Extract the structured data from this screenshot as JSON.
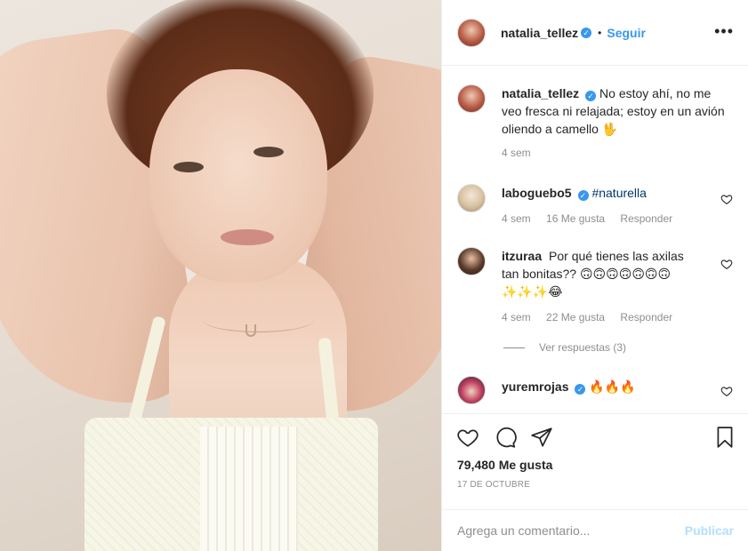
{
  "header": {
    "username": "natalia_tellez",
    "verified_icon": "verified-badge-icon",
    "separator": "•",
    "follow_label": "Seguir",
    "more_icon": "more-options-icon"
  },
  "caption": {
    "username": "natalia_tellez",
    "text": "No estoy ahí, no me veo fresca ni relajada; estoy en un avión oliendo a camello 🖖",
    "time": "4 sem"
  },
  "comments": [
    {
      "username": "laboguebo5",
      "verified": true,
      "text": "#naturella",
      "time": "4 sem",
      "likes": "16 Me gusta",
      "reply_label": "Responder"
    },
    {
      "username": "itzuraa",
      "verified": false,
      "text": "Por qué tienes las axilas tan bonitas?? 🙃🙃🙃🙃🙃🙃🙃✨✨✨😂",
      "time": "4 sem",
      "likes": "22 Me gusta",
      "reply_label": "Responder",
      "view_replies": "Ver respuestas (3)"
    },
    {
      "username": "yuremrojas",
      "verified": true,
      "text": "🔥🔥🔥"
    }
  ],
  "actions": {
    "like_icon": "heart-icon",
    "comment_icon": "comment-icon",
    "share_icon": "share-icon",
    "save_icon": "bookmark-icon",
    "likes": "79,480 Me gusta",
    "date": "17 DE OCTUBRE"
  },
  "add_comment": {
    "placeholder": "Agrega un comentario...",
    "publish_label": "Publicar"
  },
  "colors": {
    "accent": "#3897f0",
    "publish_disabled": "#b2dffc",
    "muted_text": "#8e8e8e",
    "border": "#efefef"
  }
}
